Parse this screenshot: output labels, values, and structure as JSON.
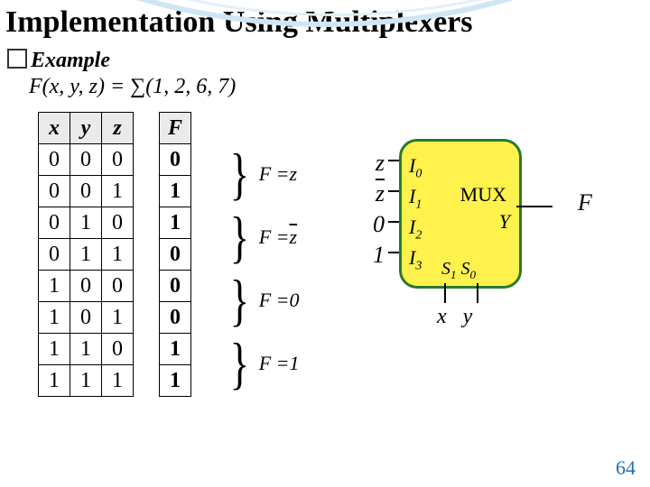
{
  "title": "Implementation Using Multiplexers",
  "bullet_label": "Example",
  "function_def": "F(x, y, z) = ∑(1, 2, 6, 7)",
  "truth_table": {
    "headers": [
      "x",
      "y",
      "z",
      "F"
    ],
    "rows": [
      {
        "x": "0",
        "y": "0",
        "z": "0",
        "F": "0"
      },
      {
        "x": "0",
        "y": "0",
        "z": "1",
        "F": "1"
      },
      {
        "x": "0",
        "y": "1",
        "z": "0",
        "F": "1"
      },
      {
        "x": "0",
        "y": "1",
        "z": "1",
        "F": "0"
      },
      {
        "x": "1",
        "y": "0",
        "z": "0",
        "F": "0"
      },
      {
        "x": "1",
        "y": "0",
        "z": "1",
        "F": "0"
      },
      {
        "x": "1",
        "y": "1",
        "z": "0",
        "F": "1"
      },
      {
        "x": "1",
        "y": "1",
        "z": "1",
        "F": "1"
      }
    ]
  },
  "pair_exprs": [
    {
      "lhs": "F = ",
      "rhs": "z",
      "overline": false
    },
    {
      "lhs": "F = ",
      "rhs": "z",
      "overline": true
    },
    {
      "lhs": "F = ",
      "rhs": "0",
      "overline": false
    },
    {
      "lhs": "F = ",
      "rhs": "1",
      "overline": false
    }
  ],
  "mux": {
    "inputs": [
      {
        "wire": "z",
        "overline": false,
        "pin": "I",
        "sub": "0"
      },
      {
        "wire": "z",
        "overline": true,
        "pin": "I",
        "sub": "1"
      },
      {
        "wire": "0",
        "overline": false,
        "pin": "I",
        "sub": "2"
      },
      {
        "wire": "1",
        "overline": false,
        "pin": "I",
        "sub": "3"
      }
    ],
    "label": "MUX",
    "out_pin": "Y",
    "out_signal": "F",
    "selects": [
      {
        "pin": "S",
        "sub": "1",
        "sig": "x"
      },
      {
        "pin": "S",
        "sub": "0",
        "sig": "y"
      }
    ]
  },
  "page_number": "64",
  "chart_data": {
    "type": "table",
    "title": "Truth table and MUX implementation of F(x,y,z)=Σ(1,2,6,7)",
    "columns": [
      "x",
      "y",
      "z",
      "F"
    ],
    "rows": [
      [
        0,
        0,
        0,
        0
      ],
      [
        0,
        0,
        1,
        1
      ],
      [
        0,
        1,
        0,
        1
      ],
      [
        0,
        1,
        1,
        0
      ],
      [
        1,
        0,
        0,
        0
      ],
      [
        1,
        0,
        1,
        0
      ],
      [
        1,
        1,
        0,
        1
      ],
      [
        1,
        1,
        1,
        1
      ]
    ],
    "mux_mapping": {
      "select_lines": [
        "x",
        "y"
      ],
      "data_inputs": {
        "I0": "z",
        "I1": "z'",
        "I2": "0",
        "I3": "1"
      },
      "output": "F"
    }
  }
}
